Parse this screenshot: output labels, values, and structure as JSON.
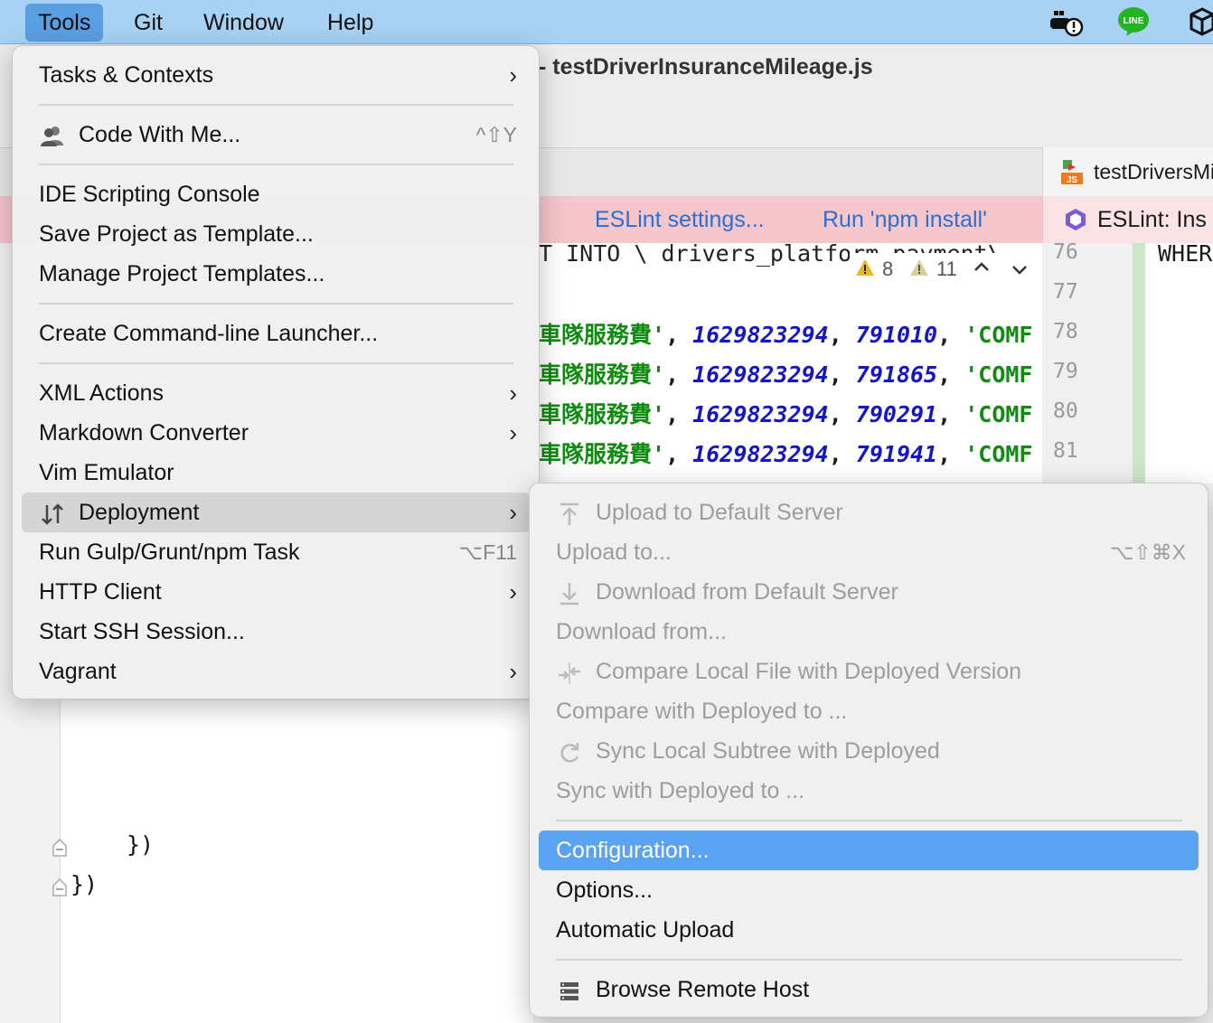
{
  "menubar": {
    "items": [
      "Tools",
      "Git",
      "Window",
      "Help"
    ],
    "tray_icons": [
      "docker-icon",
      "line-icon",
      "box-icon"
    ],
    "line_label": "LINE"
  },
  "editor": {
    "title": "- testDriverInsuranceMileage.js",
    "right_tab": "testDriversMi",
    "right_tab_badge": "JS",
    "notice_links": [
      "ESLint settings...",
      "Run 'npm install'"
    ],
    "right_notice": "ESLint: Ins",
    "partial_line": "T INTO \\ drivers_platform_payment\\",
    "warnings": {
      "a": "8",
      "b": "11"
    },
    "lines": [
      {
        "cjk": "車隊服務費'",
        "n1": "1629823294",
        "n2": "791010",
        "s": "'COMF"
      },
      {
        "cjk": "車隊服務費'",
        "n1": "1629823294",
        "n2": "791865",
        "s": "'COMF"
      },
      {
        "cjk": "車隊服務費'",
        "n1": "1629823294",
        "n2": "790291",
        "s": "'COMF"
      },
      {
        "cjk": "車隊服務費'",
        "n1": "1629823294",
        "n2": "791941",
        "s": "'COMF"
      }
    ],
    "line_numbers": [
      "76",
      "77",
      "78",
      "79",
      "80",
      "81"
    ],
    "right_code": "WHER",
    "braces": [
      "})",
      "})"
    ]
  },
  "tools_menu": {
    "tasks": "Tasks & Contexts",
    "code_with_me": "Code With Me...",
    "code_with_me_shortcut": "^⇧Y",
    "ide_console": "IDE Scripting Console",
    "save_template": "Save Project as Template...",
    "manage_templates": "Manage Project Templates...",
    "cli_launcher": "Create Command-line Launcher...",
    "xml_actions": "XML Actions",
    "markdown": "Markdown Converter",
    "vim": "Vim Emulator",
    "deployment": "Deployment",
    "gulp": "Run Gulp/Grunt/npm Task",
    "gulp_shortcut": "⌥F11",
    "http": "HTTP Client",
    "ssh": "Start SSH Session...",
    "vagrant": "Vagrant"
  },
  "deploy_menu": {
    "upload_default": "Upload to Default Server",
    "upload_to": "Upload to...",
    "upload_to_shortcut": "⌥⇧⌘X",
    "download_default": "Download from Default Server",
    "download_from": "Download from...",
    "compare_local": "Compare Local File with Deployed Version",
    "compare_with": "Compare with Deployed to ...",
    "sync_local": "Sync Local Subtree with Deployed",
    "sync_with": "Sync with Deployed to ...",
    "configuration": "Configuration...",
    "options": "Options...",
    "auto_upload": "Automatic Upload",
    "browse_remote": "Browse Remote Host"
  },
  "colors": {
    "selection": "#5aa2f2",
    "menubar": "#a7d2f4",
    "notice": "#f5c6cb"
  }
}
